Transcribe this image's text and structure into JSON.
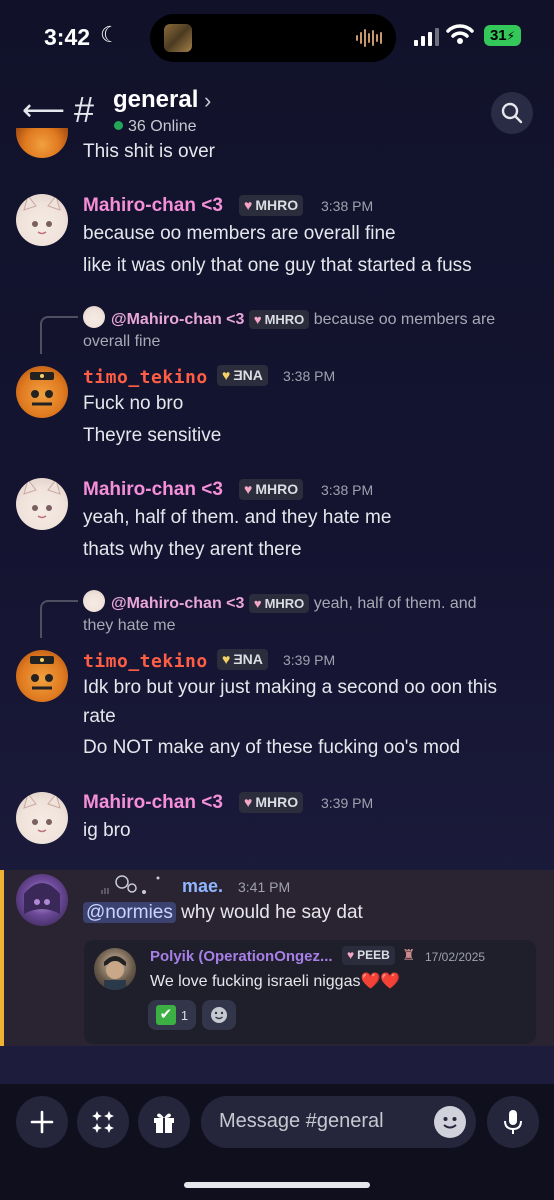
{
  "status": {
    "time": "3:42",
    "battery": "31"
  },
  "header": {
    "channel": "general",
    "online": "36 Online"
  },
  "messages": {
    "partial": {
      "text": "This shit is over"
    },
    "m1": {
      "name": "Mahiro-chan <3",
      "tag": "MHRO",
      "time": "3:38 PM",
      "lines": [
        "because oo members are overall fine",
        "like it was only that one guy that started a fuss"
      ]
    },
    "r1": {
      "name": "@Mahiro-chan <3",
      "tag": "MHRO",
      "line1": "because oo members are",
      "line2": "overall fine"
    },
    "m2": {
      "name": "timo_tekino",
      "tag": "ƎNA",
      "time": "3:38 PM",
      "lines": [
        "Fuck no bro",
        "Theyre sensitive"
      ]
    },
    "m3": {
      "name": "Mahiro-chan <3",
      "tag": "MHRO",
      "time": "3:38 PM",
      "lines": [
        "yeah, half of them. and they hate me",
        "thats why they arent there"
      ]
    },
    "r2": {
      "name": "@Mahiro-chan <3",
      "tag": "MHRO",
      "line1": "yeah, half of them. and",
      "line2": "they hate me"
    },
    "m4": {
      "name": "timo_tekino",
      "tag": "ƎNA",
      "time": "3:39 PM",
      "lines": [
        "Idk bro but your just making a second oo oon this",
        "rate",
        "Do NOT make any of these fucking oo's mod"
      ]
    },
    "m5": {
      "name": "Mahiro-chan <3",
      "tag": "MHRO",
      "time": "3:39 PM",
      "lines": [
        "ig bro"
      ]
    },
    "m6": {
      "name": "mae.",
      "time": "3:41 PM",
      "mention": "@normies",
      "text": " why would he say dat",
      "embed": {
        "name": "Polyik (OperationOngez...",
        "tag": "PEEB",
        "date": "17/02/2025",
        "text": "We love fucking israeli niggas❤️❤️",
        "reaction_count": "1"
      }
    }
  },
  "composer": {
    "placeholder": "Message #general"
  },
  "colors": {
    "accent_pink": "#f48fd8",
    "accent_orange": "#ff5d44",
    "highlight_bar": "#f0b232",
    "online_green": "#23a55a"
  }
}
